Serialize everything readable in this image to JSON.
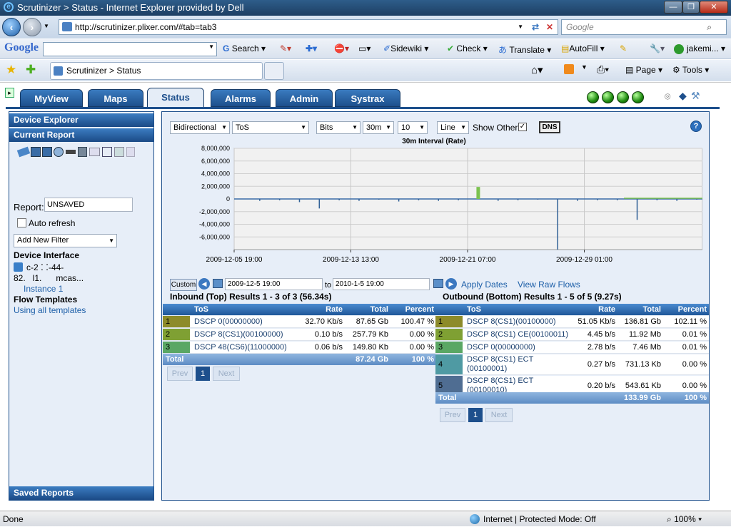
{
  "window": {
    "title": "Scrutinizer > Status - Internet Explorer provided by Dell"
  },
  "address": {
    "url": "http://scrutinizer.plixer.com/#tab=tab3",
    "search_placeholder": "Google"
  },
  "google_toolbar": {
    "logo": "Google",
    "search": "Search",
    "sidewiki": "Sidewiki",
    "check": "Check",
    "translate": "Translate",
    "autofill": "AutoFill",
    "user": "jakemi..."
  },
  "fav_bar": {
    "tab_title": "Scrutinizer > Status",
    "page": "Page",
    "tools": "Tools"
  },
  "tabs": [
    {
      "label": "MyView"
    },
    {
      "label": "Maps"
    },
    {
      "label": "Status"
    },
    {
      "label": "Alarms"
    },
    {
      "label": "Admin"
    },
    {
      "label": "Systrax"
    }
  ],
  "left": {
    "device_explorer": "Device Explorer",
    "current_report": "Current Report",
    "report_label": "Report:",
    "report_value": "UNSAVED",
    "auto_refresh": "Auto refresh",
    "add_filter": "Add New Filter",
    "device_interface": "Device Interface",
    "device_line1": "c-2 ⁚ ⁚-44-",
    "device_line2": "82.   l1.      mcas...",
    "instance": "Instance 1",
    "flow_templates": "Flow Templates",
    "using_templates": "Using all templates",
    "saved_reports": "Saved Reports"
  },
  "controls": {
    "direction": "Bidirectional",
    "report_type": "ToS",
    "unit": "Bits",
    "interval": "30m",
    "top_n": "10",
    "graph_type": "Line",
    "show_other": "Show Other",
    "dns": "DNS",
    "help": "?"
  },
  "chart_data": {
    "type": "line",
    "title": "30m Interval (Rate)",
    "ylim": [
      -8000000,
      8000000
    ],
    "yticks": [
      "8,000,000",
      "6,000,000",
      "4,000,000",
      "2,000,000",
      "0",
      "-2,000,000",
      "-4,000,000",
      "-6,000,000"
    ],
    "xticks": [
      "2009-12-05 19:00",
      "2009-12-13 13:00",
      "2009-12-21 07:00",
      "2009-12-29 01:00"
    ],
    "grid": true,
    "series": [
      {
        "values": [
          0,
          -300000,
          -200000,
          -500000,
          -1500000,
          -200000,
          -300000,
          -100000,
          -400000,
          -200000,
          -300000,
          -200000,
          1900000,
          -300000,
          -200000,
          -100000,
          -8000000,
          -300000,
          -200000,
          -200000,
          -3300000,
          -200000,
          -300000,
          -100000
        ]
      }
    ]
  },
  "date_range": {
    "custom": "Custom",
    "from": "2009-12-5 19:00",
    "to_label": "to",
    "to": "2010-1-5 19:00",
    "apply": "Apply Dates",
    "raw": "View Raw Flows"
  },
  "inbound": {
    "title": "Inbound (Top) Results 1 - 3 of 3 (56.34s)",
    "headers": [
      "ToS",
      "Rate",
      "Total",
      "Percent"
    ],
    "rows": [
      {
        "n": "1",
        "name": "DSCP 0(00000000)",
        "rate": "32.70 Kb/s",
        "total": "87.65 Gb",
        "pct": "100.47 %",
        "color": "#8d8b2a"
      },
      {
        "n": "2",
        "name": "DSCP 8(CS1)(00100000)",
        "rate": "0.10 b/s",
        "total": "257.79 Kb",
        "pct": "0.00 %",
        "color": "#7fa033"
      },
      {
        "n": "3",
        "name": "DSCP 48(CS6)(11000000)",
        "rate": "0.06 b/s",
        "total": "149.80 Kb",
        "pct": "0.00 %",
        "color": "#5aa764"
      }
    ],
    "total_label": "Total",
    "total": "87.24 Gb",
    "total_pct": "100 %",
    "prev": "Prev",
    "page": "1",
    "next": "Next"
  },
  "outbound": {
    "title": "Outbound (Bottom) Results 1 - 5 of 5 (9.27s)",
    "headers": [
      "ToS",
      "Rate",
      "Total",
      "Percent"
    ],
    "rows": [
      {
        "n": "1",
        "name": "DSCP 8(CS1)(00100000)",
        "name2": "",
        "rate": "51.05 Kb/s",
        "total": "136.81 Gb",
        "pct": "102.11 %",
        "color": "#8d8b2a"
      },
      {
        "n": "2",
        "name": "DSCP 8(CS1) CE(00100011)",
        "name2": "",
        "rate": "4.45 b/s",
        "total": "11.92 Mb",
        "pct": "0.01 %",
        "color": "#7fa033"
      },
      {
        "n": "3",
        "name": "DSCP 0(00000000)",
        "name2": "",
        "rate": "2.78 b/s",
        "total": "7.46 Mb",
        "pct": "0.01 %",
        "color": "#5aa764"
      },
      {
        "n": "4",
        "name": "DSCP 8(CS1) ECT",
        "name2": "(00100001)",
        "rate": "0.27 b/s",
        "total": "731.13 Kb",
        "pct": "0.00 %",
        "color": "#4f9aa3"
      },
      {
        "n": "5",
        "name": "DSCP 8(CS1) ECT",
        "name2": "(00100010)",
        "rate": "0.20 b/s",
        "total": "543.61 Kb",
        "pct": "0.00 %",
        "color": "#4f6d92"
      }
    ],
    "total_label": "Total",
    "total": "133.99 Gb",
    "total_pct": "100 %",
    "prev": "Prev",
    "page": "1",
    "next": "Next"
  },
  "status": {
    "done": "Done",
    "zone": "Internet | Protected Mode: Off",
    "zoom": "100%"
  }
}
